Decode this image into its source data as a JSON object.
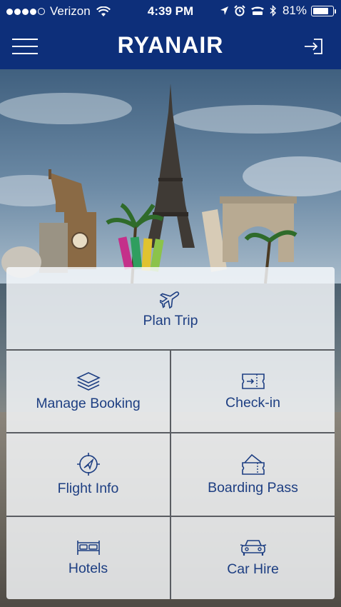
{
  "status_bar": {
    "carrier": "Verizon",
    "time": "4:39 PM",
    "battery_percent": "81%",
    "battery_level": 0.81,
    "signal_bars_filled": 4,
    "icons": [
      "wifi-icon",
      "location-arrow-icon",
      "alarm-icon",
      "tty-icon",
      "bluetooth-icon",
      "battery-icon"
    ]
  },
  "header": {
    "logo_text": "RYANAIR",
    "menu_icon": "hamburger-menu-icon",
    "login_icon": "sign-in-icon"
  },
  "menu": {
    "tiles": [
      {
        "id": "plan-trip",
        "label": "Plan Trip",
        "icon": "airplane-icon"
      },
      {
        "id": "manage-booking",
        "label": "Manage Booking",
        "icon": "layers-icon"
      },
      {
        "id": "check-in",
        "label": "Check-in",
        "icon": "ticket-icon"
      },
      {
        "id": "flight-info",
        "label": "Flight Info",
        "icon": "compass-icon"
      },
      {
        "id": "boarding-pass",
        "label": "Boarding Pass",
        "icon": "boarding-pass-icon"
      },
      {
        "id": "hotels",
        "label": "Hotels",
        "icon": "bed-icon"
      },
      {
        "id": "car-hire",
        "label": "Car Hire",
        "icon": "car-icon"
      }
    ]
  },
  "colors": {
    "brand_navy": "#0d2f7a",
    "tile_text": "#1d3e82",
    "panel_bg": "#f8fafc"
  }
}
